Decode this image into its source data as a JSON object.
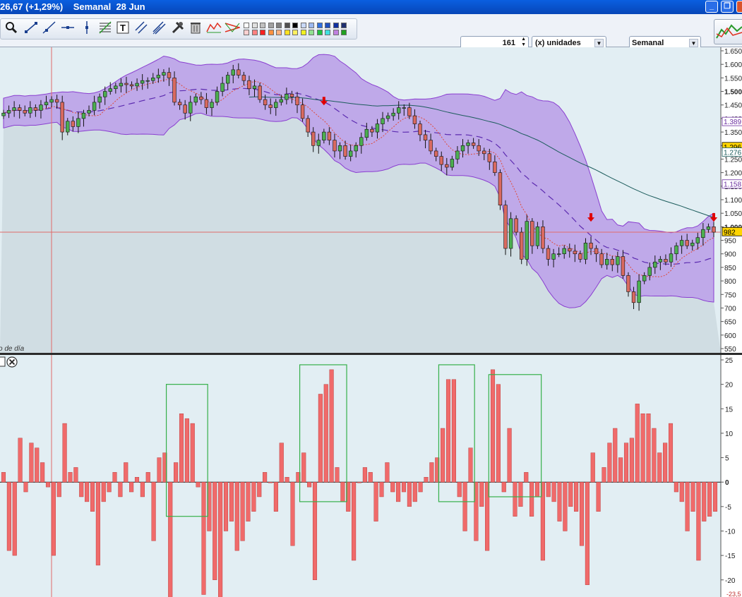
{
  "window": {
    "title_change": "26,67 (+1,29%)",
    "title_period": "Semanal",
    "title_date": "28 Jun",
    "minimize_label": "_",
    "restore_label": "❐",
    "close_label": "✕"
  },
  "toolbar": {
    "units_value": "161",
    "units_dropdown": "(x) unidades",
    "period_dropdown": "Semanal",
    "tools": [
      "zoom-icon",
      "line-icon",
      "ray-icon",
      "horizontal-line-icon",
      "vertical-line-icon",
      "fibonacci-icon",
      "text-icon",
      "parallel-icon",
      "channel-icon",
      "settings-icon",
      "trash-icon",
      "pattern-icon",
      "triangle-icon"
    ],
    "palette_rows": [
      [
        "#ffffff",
        "#e0e0e0",
        "#c0c0c0",
        "#a0a0a0",
        "#808080",
        "#505050",
        "#000000",
        "#c8d8f8",
        "#9bb8f0",
        "#3070e0",
        "#2050c0",
        "#1030a0",
        "#203070"
      ],
      [
        "#ffd0d0",
        "#ff8080",
        "#ff2020",
        "#ff9040",
        "#ffb080",
        "#ffe020",
        "#fff060",
        "#f0f020",
        "#90e090",
        "#20c040",
        "#40e0e0",
        "#c080e0",
        "#20a020"
      ]
    ]
  },
  "price_axis": {
    "ticks": [
      "1.650",
      "1.600",
      "1.550",
      "1.500",
      "1.450",
      "1.400",
      "1.350",
      "1.300",
      "1.250",
      "1.200",
      "1.150",
      "1.100",
      "1.050",
      "1.000",
      "950",
      "900",
      "850",
      "800",
      "750",
      "700",
      "650",
      "600",
      "550"
    ],
    "markers": [
      {
        "label": "1.389",
        "bg": "#ffffff",
        "fg": "#6b2fa0"
      },
      {
        "label": "1.296",
        "bg": "#ffd500",
        "fg": "#000000"
      },
      {
        "label": "1.276",
        "bg": "#ffffff",
        "fg": "#1c5c5c"
      },
      {
        "label": "1.158",
        "bg": "#ffffff",
        "fg": "#6b2fa0"
      },
      {
        "label": "982",
        "bg": "#ffd500",
        "fg": "#000000"
      }
    ],
    "footer_note": "o de día"
  },
  "indicator_axis": {
    "ticks": [
      "25",
      "20",
      "15",
      "10",
      "5",
      "0",
      "-5",
      "-10",
      "-15",
      "-20"
    ],
    "cut_label": "-23,5"
  },
  "colors": {
    "price_bg": "#e2eef3",
    "band_fill": "#b89ce6",
    "band_line": "#8a3fd0",
    "below_fill": "#c4d2d8",
    "bull": "#4caf50",
    "bear": "#d96a60",
    "ind_bar": "#f06a6a",
    "box": "#36b04a",
    "arrow": "#e00000",
    "long_ma": "#1c5c5c",
    "mid_ma": "#5c2bb0",
    "short_ma": "#e04a3a",
    "crosshair": "#e06a6a"
  },
  "chart_data": [
    {
      "type": "candlestick",
      "period": "weekly",
      "ylim": [
        550,
        1650
      ],
      "closes": [
        1420,
        1430,
        1440,
        1430,
        1420,
        1440,
        1430,
        1450,
        1460,
        1470,
        1460,
        1350,
        1390,
        1370,
        1400,
        1420,
        1430,
        1460,
        1480,
        1500,
        1510,
        1520,
        1530,
        1525,
        1520,
        1530,
        1540,
        1540,
        1550,
        1560,
        1570,
        1550,
        1460,
        1450,
        1420,
        1460,
        1480,
        1470,
        1440,
        1460,
        1500,
        1530,
        1560,
        1580,
        1560,
        1540,
        1510,
        1520,
        1470,
        1450,
        1440,
        1460,
        1470,
        1490,
        1480,
        1450,
        1400,
        1350,
        1300,
        1320,
        1350,
        1320,
        1280,
        1300,
        1260,
        1280,
        1300,
        1330,
        1360,
        1350,
        1380,
        1400,
        1410,
        1420,
        1440,
        1440,
        1410,
        1380,
        1340,
        1320,
        1280,
        1260,
        1230,
        1220,
        1250,
        1280,
        1300,
        1310,
        1300,
        1280,
        1270,
        1240,
        1200,
        1080,
        920,
        1030,
        980,
        880,
        1020,
        930,
        1000,
        920,
        880,
        900,
        900,
        920,
        910,
        900,
        880,
        940,
        920,
        900,
        860,
        880,
        860,
        890,
        820,
        760,
        720,
        800,
        820,
        850,
        870,
        880,
        870,
        900,
        930,
        950,
        930,
        940,
        960,
        990,
        1000,
        980
      ],
      "signal_arrows_week_index": [
        60,
        110,
        152,
        180
      ],
      "bands_visible": true
    },
    {
      "type": "bar",
      "ylim": [
        -23.5,
        25
      ],
      "values": [
        2,
        -14,
        -15,
        9,
        -2,
        8,
        7,
        4,
        -1,
        -15,
        -3,
        12,
        2,
        3,
        -3,
        -4,
        -6,
        -17,
        -4,
        -2,
        2,
        -3,
        4,
        -2,
        1,
        -3,
        2,
        -12,
        5,
        6,
        -26,
        4,
        14,
        13,
        12,
        -1,
        -23,
        -10,
        -20,
        -27,
        -10,
        -8,
        -14,
        -12,
        -8,
        -6,
        -3,
        2,
        0,
        -6,
        8,
        1,
        -13,
        2,
        6,
        -1,
        -20,
        18,
        20,
        23,
        3,
        -4,
        -6,
        -16,
        0,
        3,
        2,
        -8,
        -3,
        4,
        -2,
        -4,
        -2,
        -5,
        -4,
        -2,
        1,
        4,
        5,
        11,
        21,
        21,
        -3,
        -10,
        7,
        -12,
        -5,
        -14,
        23,
        20,
        -2,
        11,
        -7,
        -5,
        2,
        -7,
        -3,
        -16,
        -3,
        -4,
        -8,
        -10,
        -5,
        -6,
        -13,
        -21,
        6,
        -6,
        3,
        8,
        11,
        5,
        8,
        9,
        16,
        14,
        14,
        11,
        6,
        8,
        12,
        -2,
        -4,
        -10,
        -6,
        -16,
        -8,
        -7,
        -6
      ],
      "highlight_boxes": [
        {
          "x_from": 30,
          "x_to": 36,
          "y_from": -7,
          "y_to": 20
        },
        {
          "x_from": 54,
          "x_to": 61,
          "y_from": -4,
          "y_to": 24
        },
        {
          "x_from": 79,
          "x_to": 84,
          "y_from": -4,
          "y_to": 24
        },
        {
          "x_from": 88,
          "x_to": 96,
          "y_from": -3,
          "y_to": 22
        }
      ]
    }
  ]
}
